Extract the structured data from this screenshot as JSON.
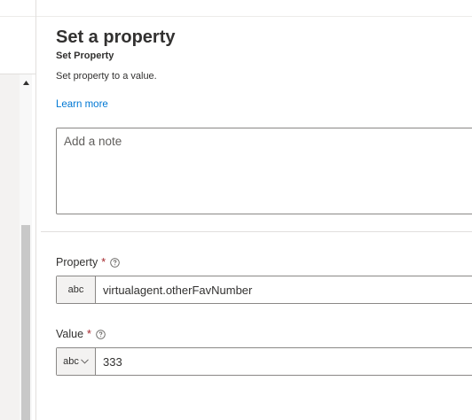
{
  "panel": {
    "title": "Set a property",
    "subtitle": "Set Property",
    "description": "Set property to a value.",
    "learn_more": "Learn more",
    "note_placeholder": "Add a note",
    "note_value": ""
  },
  "property_field": {
    "label": "Property",
    "required_mark": "*",
    "type_label": "abc",
    "value": "virtualagent.otherFavNumber"
  },
  "value_field": {
    "label": "Value",
    "required_mark": "*",
    "type_label": "abc",
    "value": "333"
  },
  "icons": {
    "help": "help-circle-icon",
    "dropdown": "chevron-down-icon",
    "scroll_up": "caret-up-icon"
  },
  "colors": {
    "link": "#0078d4",
    "required": "#a4262c",
    "text": "#323130",
    "border": "#8a8886"
  }
}
